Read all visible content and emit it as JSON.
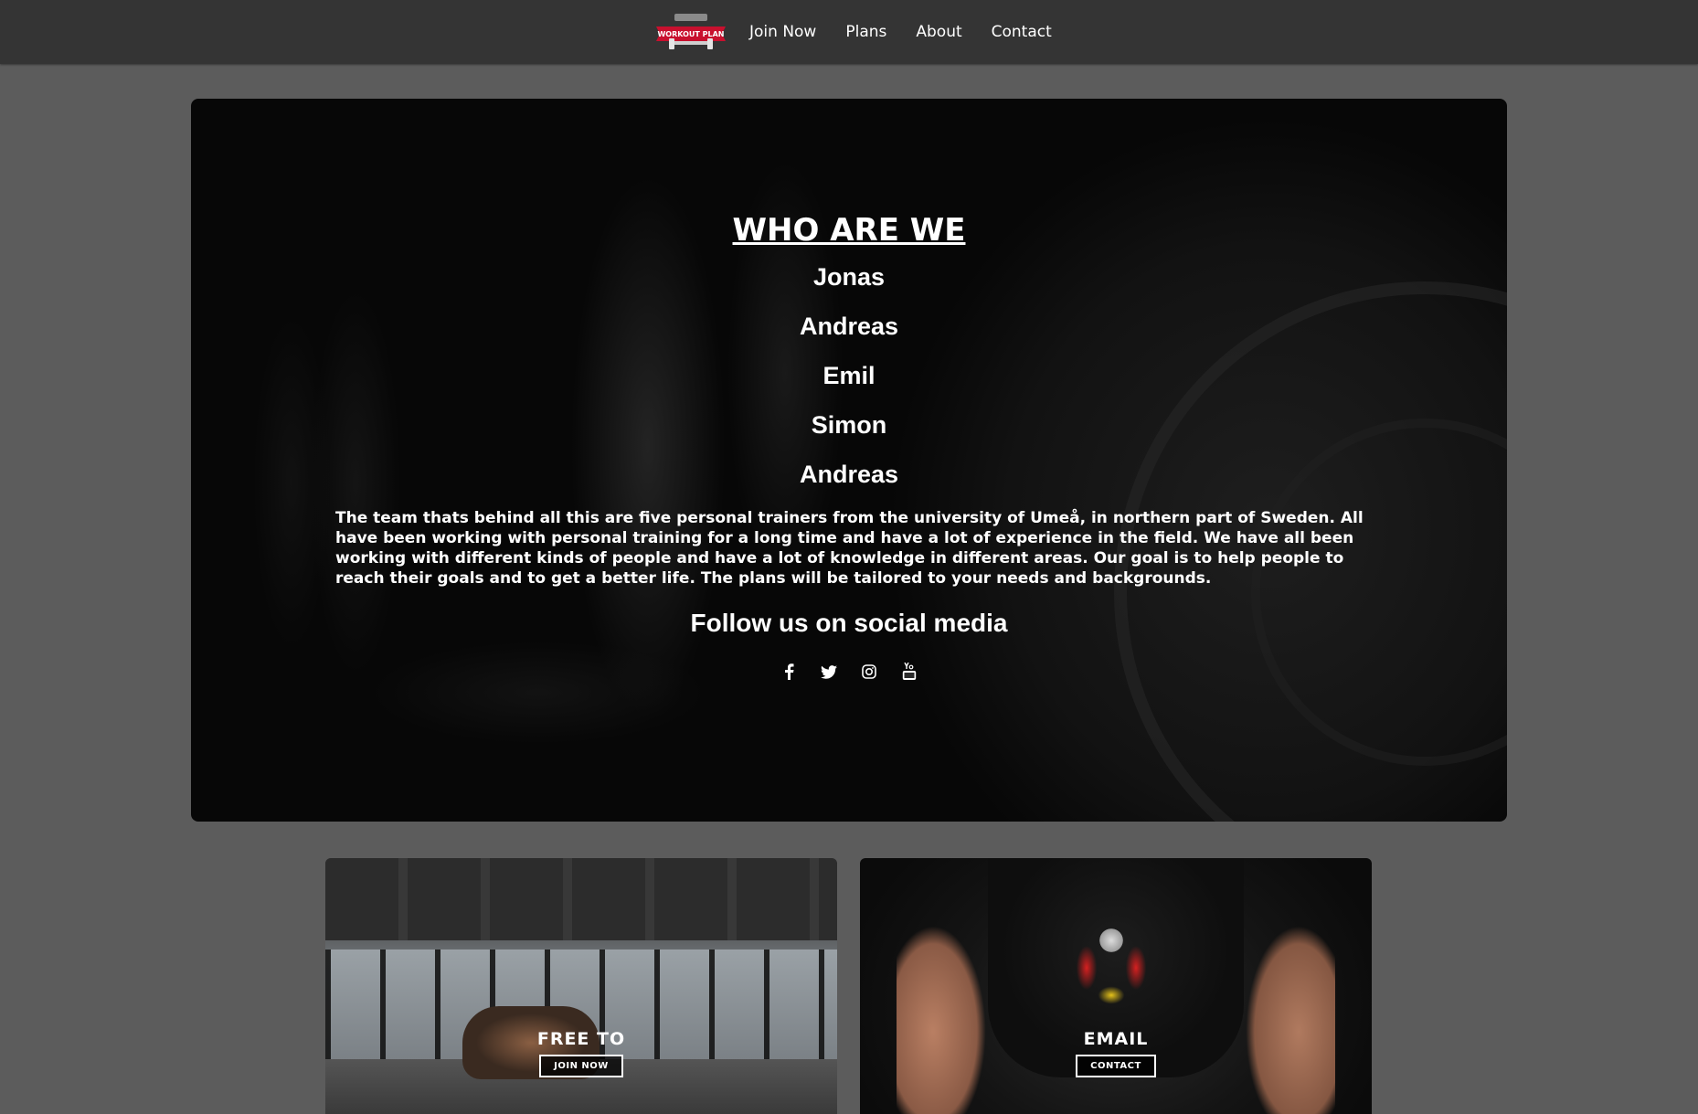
{
  "nav": {
    "logo_alt": "WORKOUT PLAN",
    "links": [
      "Join Now",
      "Plans",
      "About",
      "Contact"
    ]
  },
  "hero": {
    "title": "WHO ARE WE",
    "members": [
      "Jonas",
      "Andreas",
      "Emil",
      "Simon",
      "Andreas"
    ],
    "description": "The team thats behind all this are five personal trainers from the university of Umeå, in northern part of Sweden. All have been working with personal training for a long time and have a lot of experience in the field. We have all been working with different kinds of people and have a lot of knowledge in different areas. Our goal is to help people to reach their goals and to get a better life. The plans will be tailored to your needs and backgrounds.",
    "follow_title": "Follow us on social media",
    "socials": [
      "facebook-icon",
      "twitter-icon",
      "instagram-icon",
      "youtube-icon"
    ]
  },
  "cards": [
    {
      "title": "FREE TO",
      "button": "JOIN NOW"
    },
    {
      "title": "EMAIL",
      "button": "CONTACT"
    }
  ],
  "colors": {
    "navbar": "#343434",
    "page_bg": "#5c5c5c",
    "logo_red": "#c8102e",
    "text": "#ffffff"
  }
}
